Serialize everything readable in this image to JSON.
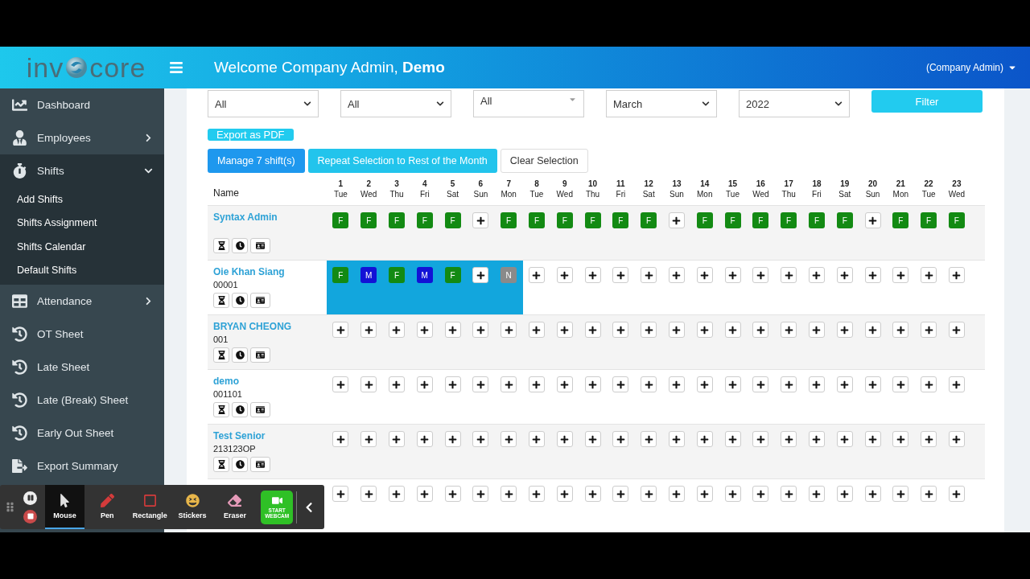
{
  "header": {
    "logo": {
      "text_before": "inv",
      "text_after": "core"
    },
    "welcome": "Welcome Company Admin, **Demo**",
    "user_menu": "(Company Admin)"
  },
  "sidebar": {
    "items": [
      {
        "label": "Dashboard",
        "kind": "chart"
      },
      {
        "label": "Employees",
        "kind": "user",
        "expanded": false
      },
      {
        "label": "Shifts",
        "kind": "stopwatch",
        "expanded": true,
        "children": [
          {
            "label": "Add Shifts"
          },
          {
            "label": "Shifts Assignment"
          },
          {
            "label": "Shifts Calendar"
          },
          {
            "label": "Default Shifts"
          }
        ]
      },
      {
        "label": "Attendance",
        "kind": "table",
        "expanded": false
      },
      {
        "label": "OT Sheet",
        "kind": "history"
      },
      {
        "label": "Late Sheet",
        "kind": "history"
      },
      {
        "label": "Late (Break) Sheet",
        "kind": "history"
      },
      {
        "label": "Early Out Sheet",
        "kind": "history"
      },
      {
        "label": "Export Summary",
        "kind": "export"
      }
    ]
  },
  "filters": [
    {
      "kind": "select",
      "value": "All"
    },
    {
      "kind": "select",
      "value": "All"
    },
    {
      "kind": "combo",
      "value": "All"
    },
    {
      "kind": "select",
      "value": "March"
    },
    {
      "kind": "select",
      "value": "2022"
    }
  ],
  "filter_button": "Filter",
  "export_button": "Export as PDF",
  "actions": [
    {
      "kind": "primary",
      "label": "Manage 7 shift(s)"
    },
    {
      "kind": "info",
      "label": "Repeat Selection to Rest of the Month"
    },
    {
      "kind": "plain",
      "label": "Clear Selection"
    }
  ],
  "table": {
    "name_header": "Name",
    "days": [
      {
        "day": "1",
        "weekday": "Tue"
      },
      {
        "day": "2",
        "weekday": "Wed"
      },
      {
        "day": "3",
        "weekday": "Thu"
      },
      {
        "day": "4",
        "weekday": "Fri"
      },
      {
        "day": "5",
        "weekday": "Sat"
      },
      {
        "day": "6",
        "weekday": "Sun"
      },
      {
        "day": "7",
        "weekday": "Mon"
      },
      {
        "day": "8",
        "weekday": "Tue"
      },
      {
        "day": "9",
        "weekday": "Wed"
      },
      {
        "day": "10",
        "weekday": "Thu"
      },
      {
        "day": "11",
        "weekday": "Fri"
      },
      {
        "day": "12",
        "weekday": "Sat"
      },
      {
        "day": "13",
        "weekday": "Sun"
      },
      {
        "day": "14",
        "weekday": "Mon"
      },
      {
        "day": "15",
        "weekday": "Tue"
      },
      {
        "day": "16",
        "weekday": "Wed"
      },
      {
        "day": "17",
        "weekday": "Thu"
      },
      {
        "day": "18",
        "weekday": "Fri"
      },
      {
        "day": "19",
        "weekday": "Sat"
      },
      {
        "day": "20",
        "weekday": "Sun"
      },
      {
        "day": "21",
        "weekday": "Mon"
      },
      {
        "day": "22",
        "weekday": "Tue"
      },
      {
        "day": "23",
        "weekday": "Wed"
      }
    ],
    "rows": [
      {
        "name": "Syntax Admin",
        "cells": [
          {
            "kind": "shift",
            "label": "F",
            "color": "#138a13",
            "selected": false
          },
          {
            "kind": "shift",
            "label": "F",
            "color": "#138a13",
            "selected": false
          },
          {
            "kind": "shift",
            "label": "F",
            "color": "#138a13",
            "selected": false
          },
          {
            "kind": "shift",
            "label": "F",
            "color": "#138a13",
            "selected": false
          },
          {
            "kind": "shift",
            "label": "F",
            "color": "#138a13",
            "selected": false
          },
          {
            "kind": "add",
            "selected": false
          },
          {
            "kind": "shift",
            "label": "F",
            "color": "#138a13",
            "selected": false
          },
          {
            "kind": "shift",
            "label": "F",
            "color": "#138a13",
            "selected": false
          },
          {
            "kind": "shift",
            "label": "F",
            "color": "#138a13",
            "selected": false
          },
          {
            "kind": "shift",
            "label": "F",
            "color": "#138a13",
            "selected": false
          },
          {
            "kind": "shift",
            "label": "F",
            "color": "#138a13",
            "selected": false
          },
          {
            "kind": "shift",
            "label": "F",
            "color": "#138a13",
            "selected": false
          },
          {
            "kind": "add",
            "selected": false
          },
          {
            "kind": "shift",
            "label": "F",
            "color": "#138a13",
            "selected": false
          },
          {
            "kind": "shift",
            "label": "F",
            "color": "#138a13",
            "selected": false
          },
          {
            "kind": "shift",
            "label": "F",
            "color": "#138a13",
            "selected": false
          },
          {
            "kind": "shift",
            "label": "F",
            "color": "#138a13",
            "selected": false
          },
          {
            "kind": "shift",
            "label": "F",
            "color": "#138a13",
            "selected": false
          },
          {
            "kind": "shift",
            "label": "F",
            "color": "#138a13",
            "selected": false
          },
          {
            "kind": "add",
            "selected": false
          },
          {
            "kind": "shift",
            "label": "F",
            "color": "#138a13",
            "selected": false
          },
          {
            "kind": "shift",
            "label": "F",
            "color": "#138a13",
            "selected": false
          },
          {
            "kind": "shift",
            "label": "F",
            "color": "#138a13",
            "selected": false
          }
        ]
      },
      {
        "name": "Oie Khan Siang",
        "code": "00001",
        "cells": [
          {
            "kind": "shift",
            "label": "F",
            "color": "#138a13",
            "selected": true
          },
          {
            "kind": "shift",
            "label": "M",
            "color": "#1212d6",
            "selected": true
          },
          {
            "kind": "shift",
            "label": "F",
            "color": "#138a13",
            "selected": true
          },
          {
            "kind": "shift",
            "label": "M",
            "color": "#1212d6",
            "selected": true
          },
          {
            "kind": "shift",
            "label": "F",
            "color": "#138a13",
            "selected": true
          },
          {
            "kind": "add",
            "selected": true
          },
          {
            "kind": "shift",
            "label": "N",
            "color": "#8a8a8a",
            "selected": true
          },
          {
            "kind": "add",
            "selected": false
          },
          {
            "kind": "add",
            "selected": false
          },
          {
            "kind": "add",
            "selected": false
          },
          {
            "kind": "add",
            "selected": false
          },
          {
            "kind": "add",
            "selected": false
          },
          {
            "kind": "add",
            "selected": false
          },
          {
            "kind": "add",
            "selected": false
          },
          {
            "kind": "add",
            "selected": false
          },
          {
            "kind": "add",
            "selected": false
          },
          {
            "kind": "add",
            "selected": false
          },
          {
            "kind": "add",
            "selected": false
          },
          {
            "kind": "add",
            "selected": false
          },
          {
            "kind": "add",
            "selected": false
          },
          {
            "kind": "add",
            "selected": false
          },
          {
            "kind": "add",
            "selected": false
          },
          {
            "kind": "add",
            "selected": false
          }
        ]
      },
      {
        "name": "BRYAN CHEONG",
        "code": "001",
        "cells": [
          {
            "kind": "add",
            "selected": false
          },
          {
            "kind": "add",
            "selected": false
          },
          {
            "kind": "add",
            "selected": false
          },
          {
            "kind": "add",
            "selected": false
          },
          {
            "kind": "add",
            "selected": false
          },
          {
            "kind": "add",
            "selected": false
          },
          {
            "kind": "add",
            "selected": false
          },
          {
            "kind": "add",
            "selected": false
          },
          {
            "kind": "add",
            "selected": false
          },
          {
            "kind": "add",
            "selected": false
          },
          {
            "kind": "add",
            "selected": false
          },
          {
            "kind": "add",
            "selected": false
          },
          {
            "kind": "add",
            "selected": false
          },
          {
            "kind": "add",
            "selected": false
          },
          {
            "kind": "add",
            "selected": false
          },
          {
            "kind": "add",
            "selected": false
          },
          {
            "kind": "add",
            "selected": false
          },
          {
            "kind": "add",
            "selected": false
          },
          {
            "kind": "add",
            "selected": false
          },
          {
            "kind": "add",
            "selected": false
          },
          {
            "kind": "add",
            "selected": false
          },
          {
            "kind": "add",
            "selected": false
          },
          {
            "kind": "add",
            "selected": false
          }
        ]
      },
      {
        "name": "demo",
        "code": "001101",
        "cells": [
          {
            "kind": "add",
            "selected": false
          },
          {
            "kind": "add",
            "selected": false
          },
          {
            "kind": "add",
            "selected": false
          },
          {
            "kind": "add",
            "selected": false
          },
          {
            "kind": "add",
            "selected": false
          },
          {
            "kind": "add",
            "selected": false
          },
          {
            "kind": "add",
            "selected": false
          },
          {
            "kind": "add",
            "selected": false
          },
          {
            "kind": "add",
            "selected": false
          },
          {
            "kind": "add",
            "selected": false
          },
          {
            "kind": "add",
            "selected": false
          },
          {
            "kind": "add",
            "selected": false
          },
          {
            "kind": "add",
            "selected": false
          },
          {
            "kind": "add",
            "selected": false
          },
          {
            "kind": "add",
            "selected": false
          },
          {
            "kind": "add",
            "selected": false
          },
          {
            "kind": "add",
            "selected": false
          },
          {
            "kind": "add",
            "selected": false
          },
          {
            "kind": "add",
            "selected": false
          },
          {
            "kind": "add",
            "selected": false
          },
          {
            "kind": "add",
            "selected": false
          },
          {
            "kind": "add",
            "selected": false
          },
          {
            "kind": "add",
            "selected": false
          }
        ]
      },
      {
        "name": "Test Senior",
        "code": "213123OP",
        "cells": [
          {
            "kind": "add",
            "selected": false
          },
          {
            "kind": "add",
            "selected": false
          },
          {
            "kind": "add",
            "selected": false
          },
          {
            "kind": "add",
            "selected": false
          },
          {
            "kind": "add",
            "selected": false
          },
          {
            "kind": "add",
            "selected": false
          },
          {
            "kind": "add",
            "selected": false
          },
          {
            "kind": "add",
            "selected": false
          },
          {
            "kind": "add",
            "selected": false
          },
          {
            "kind": "add",
            "selected": false
          },
          {
            "kind": "add",
            "selected": false
          },
          {
            "kind": "add",
            "selected": false
          },
          {
            "kind": "add",
            "selected": false
          },
          {
            "kind": "add",
            "selected": false
          },
          {
            "kind": "add",
            "selected": false
          },
          {
            "kind": "add",
            "selected": false
          },
          {
            "kind": "add",
            "selected": false
          },
          {
            "kind": "add",
            "selected": false
          },
          {
            "kind": "add",
            "selected": false
          },
          {
            "kind": "add",
            "selected": false
          },
          {
            "kind": "add",
            "selected": false
          },
          {
            "kind": "add",
            "selected": false
          },
          {
            "kind": "add",
            "selected": false
          }
        ]
      },
      {
        "cells": [
          {
            "kind": "add",
            "selected": false
          },
          {
            "kind": "add",
            "selected": false
          },
          {
            "kind": "add",
            "selected": false
          },
          {
            "kind": "add",
            "selected": false
          },
          {
            "kind": "add",
            "selected": false
          },
          {
            "kind": "add",
            "selected": false
          },
          {
            "kind": "add",
            "selected": false
          },
          {
            "kind": "add",
            "selected": false
          },
          {
            "kind": "add",
            "selected": false
          },
          {
            "kind": "add",
            "selected": false
          },
          {
            "kind": "add",
            "selected": false
          },
          {
            "kind": "add",
            "selected": false
          },
          {
            "kind": "add",
            "selected": false
          },
          {
            "kind": "add",
            "selected": false
          },
          {
            "kind": "add",
            "selected": false
          },
          {
            "kind": "add",
            "selected": false
          },
          {
            "kind": "add",
            "selected": false
          },
          {
            "kind": "add",
            "selected": false
          },
          {
            "kind": "add",
            "selected": false
          },
          {
            "kind": "add",
            "selected": false
          },
          {
            "kind": "add",
            "selected": false
          },
          {
            "kind": "add",
            "selected": false
          },
          {
            "kind": "add",
            "selected": false
          }
        ]
      }
    ]
  },
  "recorder": {
    "tools": [
      {
        "kind": "mouse",
        "label": "Mouse",
        "selected": true
      },
      {
        "kind": "pen",
        "label": "Pen",
        "selected": false
      },
      {
        "kind": "rectangle",
        "label": "Rectangle",
        "selected": false
      },
      {
        "kind": "stickers",
        "label": "Stickers",
        "selected": false
      },
      {
        "kind": "eraser",
        "label": "Eraser",
        "selected": false
      }
    ],
    "webcam_button": [
      "START",
      "WEBCAM"
    ]
  }
}
